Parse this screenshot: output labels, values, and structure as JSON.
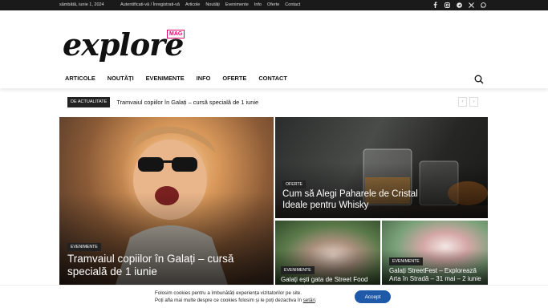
{
  "topbar": {
    "date": "sâmbătă, iunie 1, 2024",
    "links": [
      "Autentificati-vă / Înregistrati-vă",
      "Articole",
      "Noutăți",
      "Evenimente",
      "Info",
      "Oferte",
      "Contact"
    ],
    "social_icons": [
      "facebook-icon",
      "instagram-icon",
      "telegram-icon",
      "x-icon",
      "whatsapp-icon"
    ]
  },
  "logo": {
    "word": "explore",
    "badge": "MAG"
  },
  "nav": {
    "items": [
      "ARTICOLE",
      "NOUTĂȚI",
      "EVENIMENTE",
      "INFO",
      "OFERTE",
      "CONTACT"
    ]
  },
  "ticker": {
    "label": "DE ACTUALITATE",
    "headline": "Tramvaiul copiilor în Galați – cursă specială de 1 iunie"
  },
  "featured": [
    {
      "category": "EVENIMENTE",
      "title": "Tramvaiul copiilor în Galați – cursă specială de 1 iunie"
    },
    {
      "category": "OFERTE",
      "title": "Cum să Alegi Paharele de Cristal Ideale pentru Whisky"
    },
    {
      "category": "EVENIMENTE",
      "title": "Galați ești gata de Street Food"
    },
    {
      "category": "EVENIMENTE",
      "title": "Galați StreetFest – Explorează Arta în Stradă – 31 mai – 2 iunie"
    }
  ],
  "cookie": {
    "line1": "Folosim cookies pentru a îmbunătăți experiența vizitatorilor pe site.",
    "line2_pre": "Poți afla mai multe despre ce cookies folosim și le poți dezactiva în ",
    "line2_link": "setări",
    "line2_post": ".",
    "accept": "Accept"
  },
  "colors": {
    "brand_accent": "#e5006e",
    "accept_button": "#1e5aa8",
    "topbar": "#1a1a1a"
  }
}
